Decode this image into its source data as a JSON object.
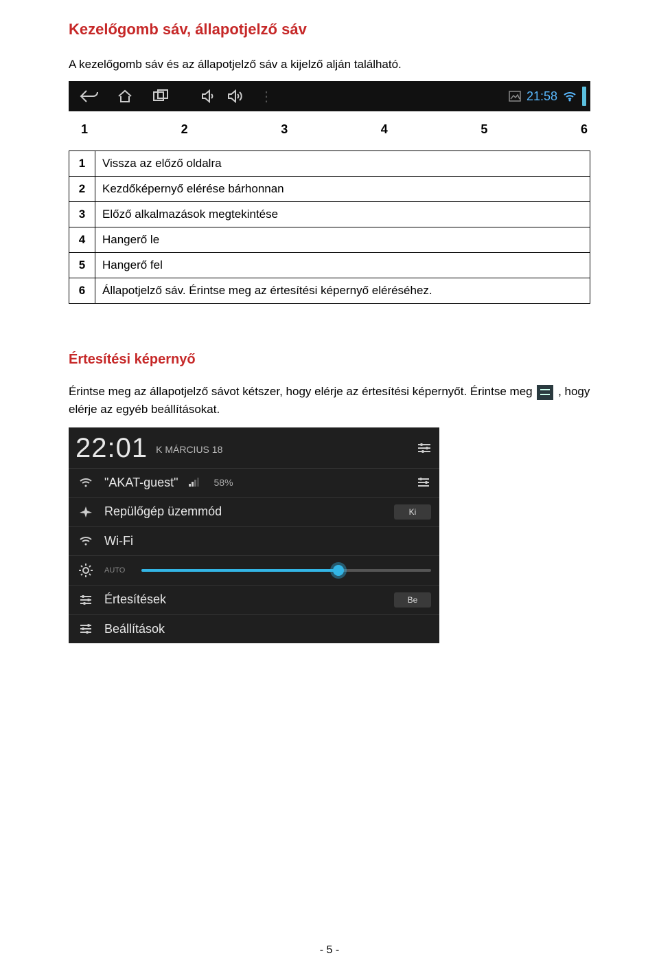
{
  "doc": {
    "title": "Kezelőgomb sáv, állapotjelző sáv",
    "intro": "A kezelőgomb sáv és az állapotjelző sáv a kijelző alján található.",
    "statusbar": {
      "clock": "21:58"
    },
    "labels": {
      "n1": "1",
      "n2": "2",
      "n3": "3",
      "n4": "4",
      "n5": "5",
      "n6": "6"
    },
    "legend": {
      "r1n": "1",
      "r1t": "Vissza az előző oldalra",
      "r2n": "2",
      "r2t": "Kezdőképernyő elérése bárhonnan",
      "r3n": "3",
      "r3t": "Előző alkalmazások megtekintése",
      "r4n": "4",
      "r4t": "Hangerő le",
      "r5n": "5",
      "r5t": "Hangerő fel",
      "r6n": "6",
      "r6t": "Állapotjelző sáv. Érintse meg az értesítési képernyő eléréséhez."
    },
    "section2_title": "Értesítési képernyő",
    "section2_text_a": "Érintse meg az állapotjelző sávot kétszer, hogy elérje az értesítési képernyőt. Érintse meg ",
    "section2_text_b": ", hogy elérje az egyéb beállításokat.",
    "shade": {
      "time": "22:01",
      "date": "K MÁRCIUS 18",
      "wifi_name": "\"AKAT-guest\"",
      "wifi_pct": "58%",
      "airplane": "Repülőgép üzemmód",
      "airplane_state": "Ki",
      "wifi_label": "Wi-Fi",
      "auto": "AUTO",
      "notifications": "Értesítések",
      "notifications_state": "Be",
      "settings": "Beállítások"
    },
    "page_num": "- 5 -"
  }
}
